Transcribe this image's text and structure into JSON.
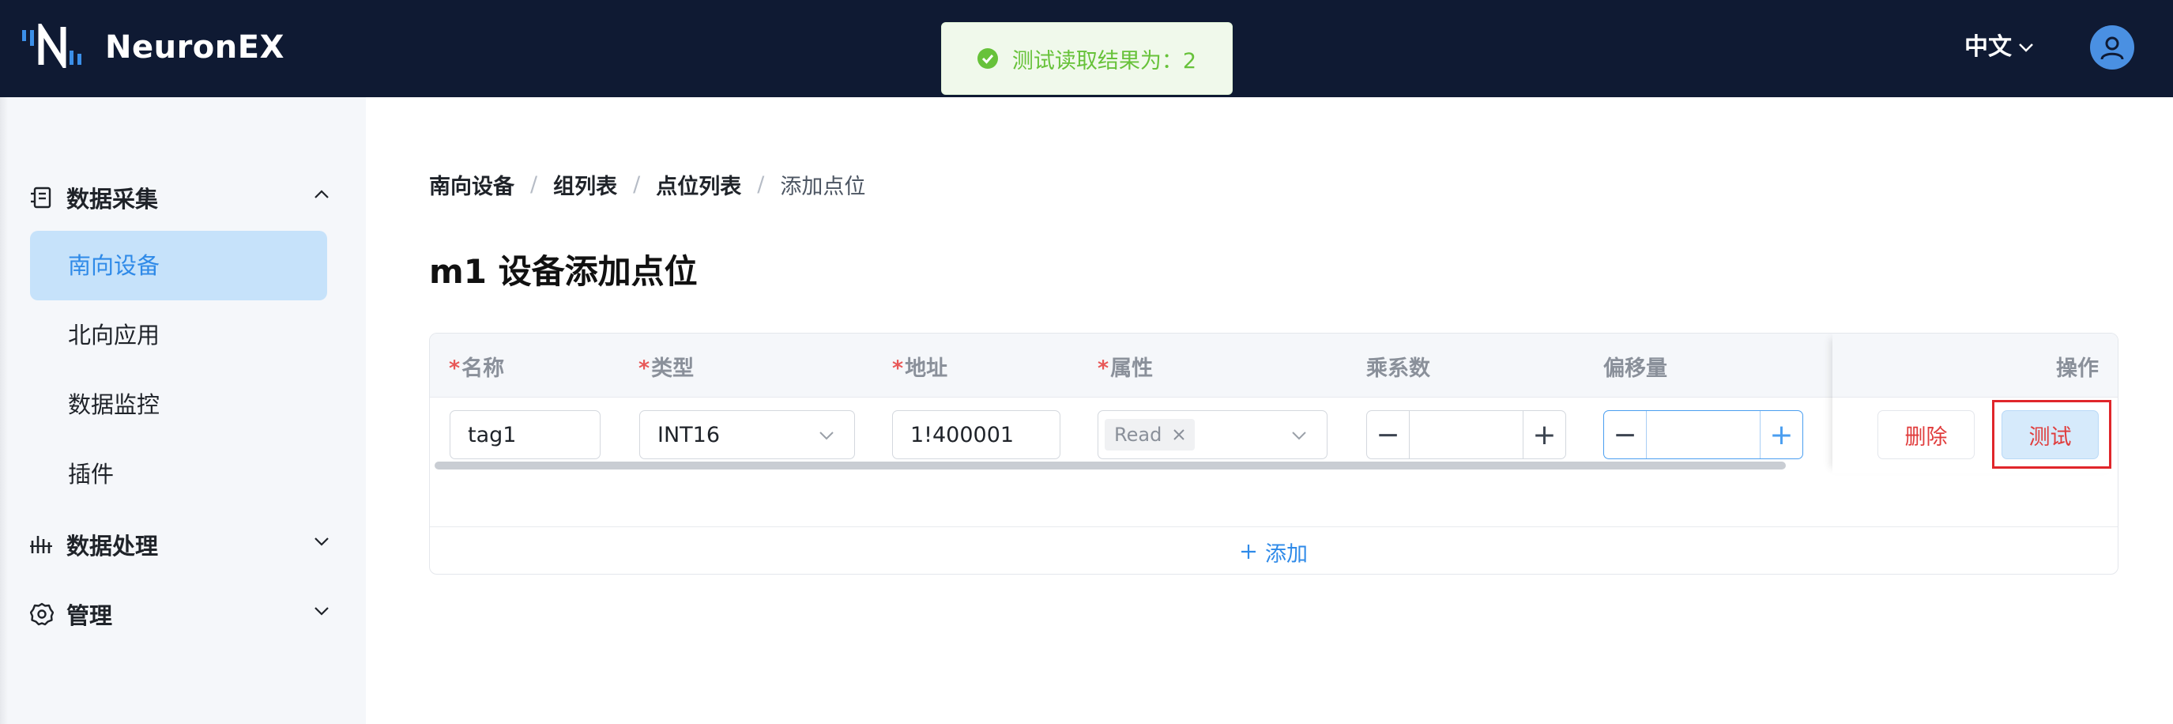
{
  "header": {
    "brand": "NeuronEX",
    "language": "中文"
  },
  "toast": {
    "message": "测试读取结果为：2",
    "color": "#67c23a"
  },
  "sidebar": {
    "groups": [
      {
        "label": "数据采集",
        "icon": "data-collection-icon",
        "expanded": true
      },
      {
        "label": "数据处理",
        "icon": "data-processing-icon",
        "expanded": false
      },
      {
        "label": "管理",
        "icon": "gear-icon",
        "expanded": false
      }
    ],
    "items": [
      {
        "label": "南向设备",
        "active": true
      },
      {
        "label": "北向应用",
        "active": false
      },
      {
        "label": "数据监控",
        "active": false
      },
      {
        "label": "插件",
        "active": false
      }
    ]
  },
  "breadcrumb": {
    "items": [
      "南向设备",
      "组列表",
      "点位列表"
    ],
    "separator": "/",
    "current": "添加点位"
  },
  "page": {
    "title": "m1 设备添加点位"
  },
  "table": {
    "required_mark": "*",
    "headers": {
      "name": "名称",
      "type": "类型",
      "address": "地址",
      "attribute": "属性",
      "multiplier": "乘系数",
      "offset": "偏移量",
      "actions": "操作"
    },
    "row": {
      "name": "tag1",
      "type": "INT16",
      "address": "1!400001",
      "attribute_tag": "Read",
      "multiplier": "",
      "offset": ""
    },
    "delete_label": "删除",
    "test_label": "测试",
    "add_label": "添加"
  },
  "colors": {
    "header_bg": "#0f1a33",
    "accent": "#2f8ae8",
    "danger": "#e03c3c",
    "active_menu_bg": "#c6e2fa"
  }
}
